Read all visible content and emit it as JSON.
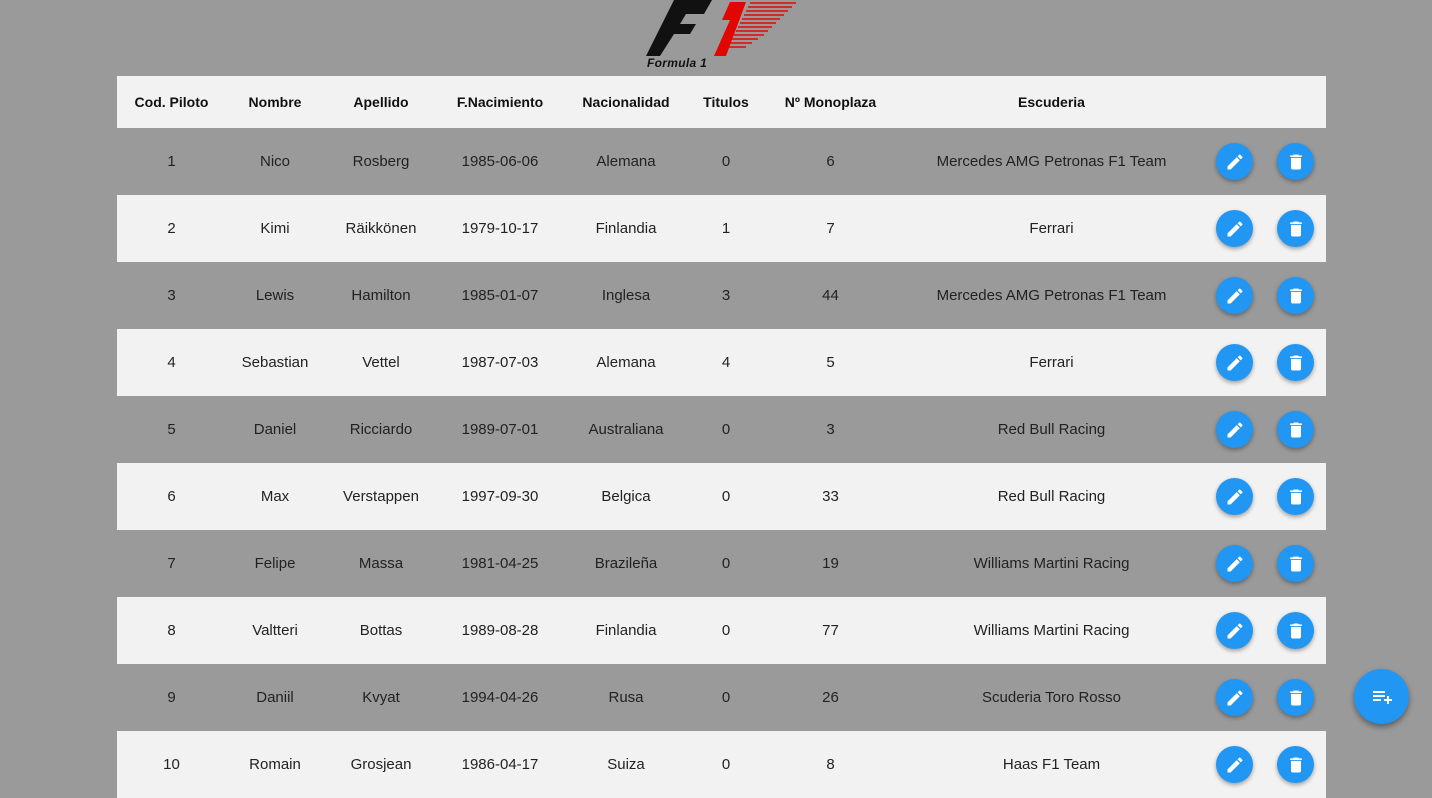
{
  "logo": {
    "text": "Formula 1"
  },
  "table": {
    "headers": [
      "Cod. Piloto",
      "Nombre",
      "Apellido",
      "F.Nacimiento",
      "Nacionalidad",
      "Titulos",
      "Nº Monoplaza",
      "Escuderia"
    ],
    "rows": [
      {
        "cod": "1",
        "nombre": "Nico",
        "apellido": "Rosberg",
        "nacimiento": "1985-06-06",
        "nacionalidad": "Alemana",
        "titulos": "0",
        "monoplaza": "6",
        "escuderia": "Mercedes AMG Petronas F1 Team"
      },
      {
        "cod": "2",
        "nombre": "Kimi",
        "apellido": "Räikkönen",
        "nacimiento": "1979-10-17",
        "nacionalidad": "Finlandia",
        "titulos": "1",
        "monoplaza": "7",
        "escuderia": "Ferrari"
      },
      {
        "cod": "3",
        "nombre": "Lewis",
        "apellido": "Hamilton",
        "nacimiento": "1985-01-07",
        "nacionalidad": "Inglesa",
        "titulos": "3",
        "monoplaza": "44",
        "escuderia": "Mercedes AMG Petronas F1 Team"
      },
      {
        "cod": "4",
        "nombre": "Sebastian",
        "apellido": "Vettel",
        "nacimiento": "1987-07-03",
        "nacionalidad": "Alemana",
        "titulos": "4",
        "monoplaza": "5",
        "escuderia": "Ferrari"
      },
      {
        "cod": "5",
        "nombre": "Daniel",
        "apellido": "Ricciardo",
        "nacimiento": "1989-07-01",
        "nacionalidad": "Australiana",
        "titulos": "0",
        "monoplaza": "3",
        "escuderia": "Red Bull Racing"
      },
      {
        "cod": "6",
        "nombre": "Max",
        "apellido": "Verstappen",
        "nacimiento": "1997-09-30",
        "nacionalidad": "Belgica",
        "titulos": "0",
        "monoplaza": "33",
        "escuderia": "Red Bull Racing"
      },
      {
        "cod": "7",
        "nombre": "Felipe",
        "apellido": "Massa",
        "nacimiento": "1981-04-25",
        "nacionalidad": "Brazileña",
        "titulos": "0",
        "monoplaza": "19",
        "escuderia": "Williams Martini Racing"
      },
      {
        "cod": "8",
        "nombre": "Valtteri",
        "apellido": "Bottas",
        "nacimiento": "1989-08-28",
        "nacionalidad": "Finlandia",
        "titulos": "0",
        "monoplaza": "77",
        "escuderia": "Williams Martini Racing"
      },
      {
        "cod": "9",
        "nombre": "Daniil",
        "apellido": "Kvyat",
        "nacimiento": "1994-04-26",
        "nacionalidad": "Rusa",
        "titulos": "0",
        "monoplaza": "26",
        "escuderia": "Scuderia Toro Rosso"
      },
      {
        "cod": "10",
        "nombre": "Romain",
        "apellido": "Grosjean",
        "nacimiento": "1986-04-17",
        "nacionalidad": "Suiza",
        "titulos": "0",
        "monoplaza": "8",
        "escuderia": "Haas F1 Team"
      }
    ]
  },
  "actions": {
    "edit_icon": "pencil-icon",
    "delete_icon": "trash-icon",
    "add_icon": "playlist-add-icon"
  },
  "colors": {
    "accent": "#2196f3",
    "background": "#9a9a9a",
    "row_light": "#f2f2f2",
    "logo_red": "#e10600"
  }
}
